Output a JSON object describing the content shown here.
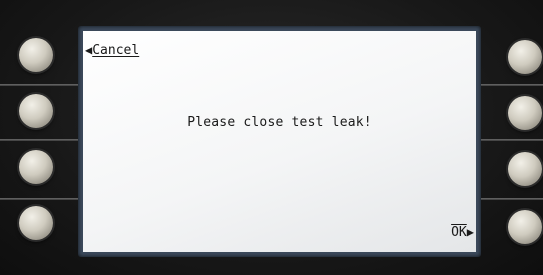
{
  "screen": {
    "cancel_label": "Cancel",
    "cancel_arrow": "◀",
    "message": "Please close test leak!",
    "ok_label": "OK",
    "ok_arrow": "▶"
  },
  "hardware": {
    "left_buttons": 4,
    "right_buttons": 4
  },
  "colors": {
    "screen_background": "#f4f5f6",
    "bezel": "#3c4a5c",
    "text": "#1a1a1a"
  }
}
